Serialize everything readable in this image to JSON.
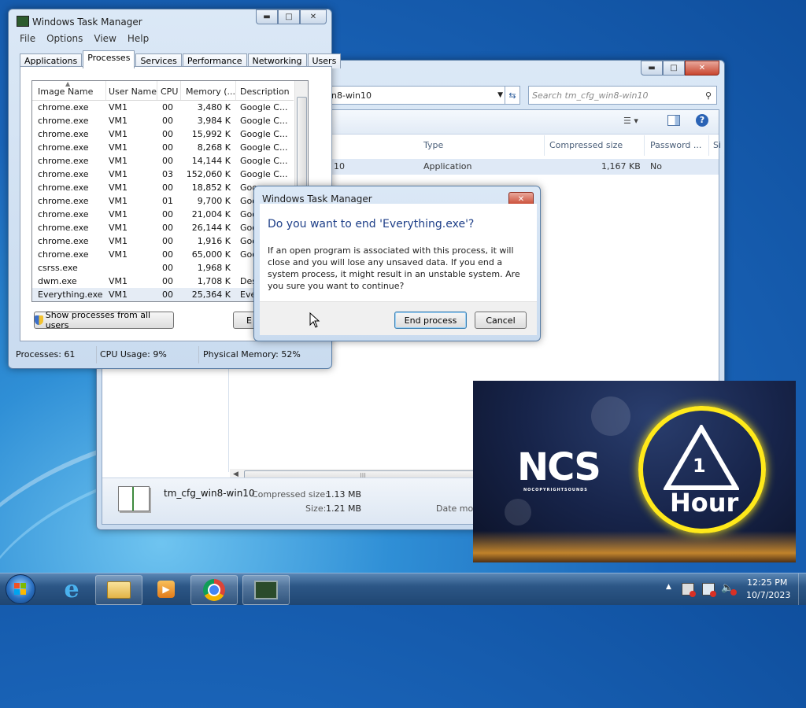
{
  "colors": {
    "accent": "#1e5aa8",
    "close_red": "#c8452e",
    "selection": "#e5ecf5"
  },
  "explorer": {
    "address_text": "in8-win10",
    "search_placeholder": "Search tm_cfg_win8-win10",
    "columns": [
      "Type",
      "Compressed size",
      "Password ...",
      "Si"
    ],
    "row": {
      "name": "10",
      "type": "Application",
      "compressed_size": "1,167 KB",
      "password": "No"
    },
    "details": {
      "name": "tm_cfg_win8-win10",
      "compressed_label": "Compressed size:",
      "compressed_value": "1.13 MB",
      "size_label": "Size:",
      "size_value": "1.21 MB",
      "date_label": "Date mod"
    }
  },
  "taskmgr": {
    "title": "Windows Task Manager",
    "menu": [
      "File",
      "Options",
      "View",
      "Help"
    ],
    "tabs": [
      "Applications",
      "Processes",
      "Services",
      "Performance",
      "Networking",
      "Users"
    ],
    "active_tab": "Processes",
    "columns": [
      "Image Name",
      "User Name",
      "CPU",
      "Memory (...",
      "Description"
    ],
    "processes": [
      {
        "name": "chrome.exe",
        "user": "VM1",
        "cpu": "00",
        "mem": "3,480 K",
        "desc": "Google C..."
      },
      {
        "name": "chrome.exe",
        "user": "VM1",
        "cpu": "00",
        "mem": "3,984 K",
        "desc": "Google C..."
      },
      {
        "name": "chrome.exe",
        "user": "VM1",
        "cpu": "00",
        "mem": "15,992 K",
        "desc": "Google C..."
      },
      {
        "name": "chrome.exe",
        "user": "VM1",
        "cpu": "00",
        "mem": "8,268 K",
        "desc": "Google C..."
      },
      {
        "name": "chrome.exe",
        "user": "VM1",
        "cpu": "00",
        "mem": "14,144 K",
        "desc": "Google C..."
      },
      {
        "name": "chrome.exe",
        "user": "VM1",
        "cpu": "03",
        "mem": "152,060 K",
        "desc": "Google C..."
      },
      {
        "name": "chrome.exe",
        "user": "VM1",
        "cpu": "00",
        "mem": "18,852 K",
        "desc": "Goo"
      },
      {
        "name": "chrome.exe",
        "user": "VM1",
        "cpu": "01",
        "mem": "9,700 K",
        "desc": "Goo"
      },
      {
        "name": "chrome.exe",
        "user": "VM1",
        "cpu": "00",
        "mem": "21,004 K",
        "desc": "Goo"
      },
      {
        "name": "chrome.exe",
        "user": "VM1",
        "cpu": "00",
        "mem": "26,144 K",
        "desc": "Goo"
      },
      {
        "name": "chrome.exe",
        "user": "VM1",
        "cpu": "00",
        "mem": "1,916 K",
        "desc": "Goo"
      },
      {
        "name": "chrome.exe",
        "user": "VM1",
        "cpu": "00",
        "mem": "65,000 K",
        "desc": "Goo"
      },
      {
        "name": "csrss.exe",
        "user": "",
        "cpu": "00",
        "mem": "1,968 K",
        "desc": ""
      },
      {
        "name": "dwm.exe",
        "user": "VM1",
        "cpu": "00",
        "mem": "1,708 K",
        "desc": "Des"
      },
      {
        "name": "Everything.exe",
        "user": "VM1",
        "cpu": "00",
        "mem": "25,364 K",
        "desc": "Eve"
      }
    ],
    "show_all_button": "Show processes from all users",
    "end_button_partial": "E",
    "status": {
      "processes": "Processes: 61",
      "cpu": "CPU Usage: 9%",
      "memory": "Physical Memory: 52%"
    }
  },
  "dialog": {
    "title": "Windows Task Manager",
    "heading": "Do you want to end 'Everything.exe'?",
    "body": "If an open program is associated with this process, it will close and you will lose any unsaved data. If you end a system process, it might result in an unstable system. Are you sure you want to continue?",
    "end_button": "End process",
    "cancel_button": "Cancel"
  },
  "video": {
    "logo": "NCS",
    "logo_sub": "NOCOPYRIGHTSOUNDS",
    "number": "1",
    "label": "Hour"
  },
  "tray": {
    "time": "12:25 PM",
    "date": "10/7/2023"
  },
  "taskbar_icons": [
    "start-orb-icon",
    "internet-explorer-icon",
    "folder-icon",
    "media-player-icon",
    "chrome-icon",
    "task-manager-icon"
  ]
}
